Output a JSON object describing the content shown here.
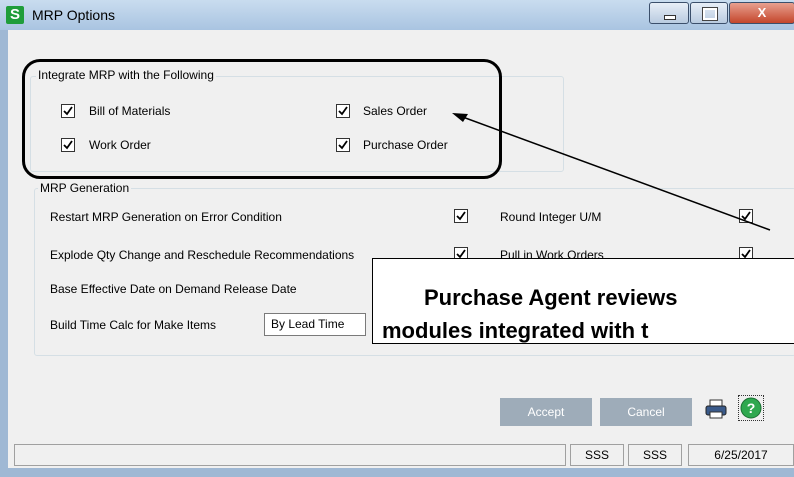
{
  "window": {
    "title": "MRP Options",
    "app_icon_letter": "S",
    "close_glyph": "X"
  },
  "integrate_group": {
    "title": "Integrate MRP with the Following",
    "items": [
      {
        "label": "Bill of Materials",
        "checked": true
      },
      {
        "label": "Sales Order",
        "checked": true
      },
      {
        "label": "Work Order",
        "checked": true
      },
      {
        "label": "Purchase Order",
        "checked": true
      }
    ]
  },
  "generation_group": {
    "title": "MRP Generation",
    "restart_label": "Restart MRP Generation on Error Condition",
    "explode_label": "Explode Qty Change and  Reschedule Recommendations",
    "base_effective_label": "Base Effective Date on Demand Release Date",
    "build_time_label": "Build Time Calc for Make Items",
    "build_time_value": "By Lead Time",
    "round_label": "Round Integer U/M",
    "pull_in_label": "Pull in Work Orders"
  },
  "buttons": {
    "accept": "Accept",
    "cancel": "Cancel"
  },
  "statusbar": {
    "cell1": "SSS",
    "cell2": "SSS",
    "date": "6/25/2017"
  },
  "callout": {
    "line1": "Purchase Agent reviews",
    "line2": "modules integrated with t"
  },
  "colors": {
    "title_bar": "#b4cbe4",
    "button_disabled": "#9eacb9",
    "logo_green": "#1f9d3a"
  }
}
